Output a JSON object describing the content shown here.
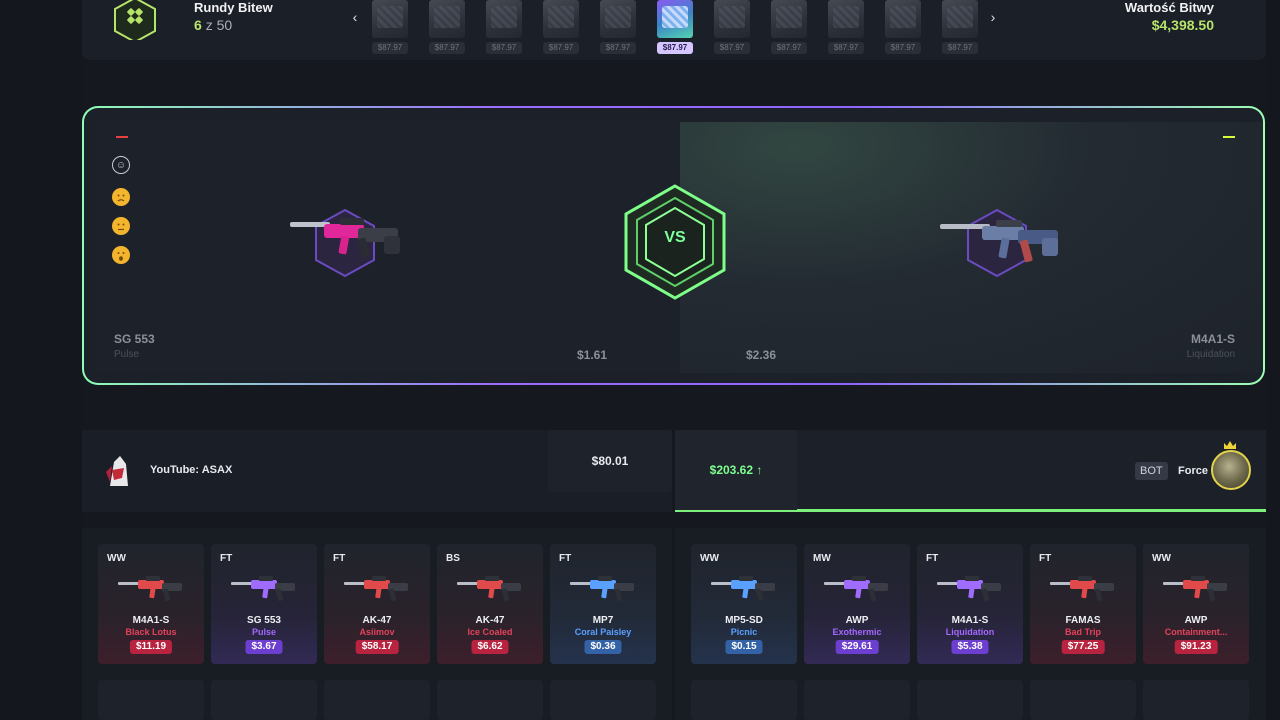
{
  "topbar": {
    "rounds_label": "Rundy Bitew",
    "rounds_current": "6",
    "rounds_sep": "z 50",
    "battle_value_label": "Wartość Bitwy",
    "battle_value": "$4,398.50",
    "nav_prev": "‹",
    "nav_next": "›",
    "cases": [
      {
        "price": "$87.97",
        "active": false
      },
      {
        "price": "$87.97",
        "active": false
      },
      {
        "price": "$87.97",
        "active": false
      },
      {
        "price": "$87.97",
        "active": false
      },
      {
        "price": "$87.97",
        "active": false
      },
      {
        "price": "$87.97",
        "active": true
      },
      {
        "price": "$87.97",
        "active": false
      },
      {
        "price": "$87.97",
        "active": false
      },
      {
        "price": "$87.97",
        "active": false
      },
      {
        "price": "$87.97",
        "active": false
      },
      {
        "price": "$87.97",
        "active": false
      }
    ]
  },
  "arena": {
    "vs": "VS",
    "left": {
      "name": "SG 553",
      "skin": "Pulse",
      "price": "$1.61"
    },
    "right": {
      "name": "M4A1-S",
      "skin": "Liquidation",
      "price": "$2.36"
    },
    "emojis": [
      "☺",
      "•",
      "•",
      "•"
    ]
  },
  "players": {
    "left": {
      "name": "YouTube: ASAX",
      "total": "$80.01"
    },
    "right": {
      "badge": "BOT",
      "name": "Force",
      "total": "$203.62 ↑"
    }
  },
  "items_left": [
    {
      "wear": "WW",
      "name": "M4A1-S",
      "skin": "Black Lotus",
      "price": "$11.19",
      "rarity": "red"
    },
    {
      "wear": "FT",
      "name": "SG 553",
      "skin": "Pulse",
      "price": "$3.67",
      "rarity": "purple"
    },
    {
      "wear": "FT",
      "name": "AK-47",
      "skin": "Asiimov",
      "price": "$58.17",
      "rarity": "red"
    },
    {
      "wear": "BS",
      "name": "AK-47",
      "skin": "Ice Coaled",
      "price": "$6.62",
      "rarity": "red"
    },
    {
      "wear": "FT",
      "name": "MP7",
      "skin": "Coral Paisley",
      "price": "$0.36",
      "rarity": "blue"
    }
  ],
  "items_right": [
    {
      "wear": "WW",
      "name": "MP5-SD",
      "skin": "Picnic",
      "price": "$0.15",
      "rarity": "blue"
    },
    {
      "wear": "MW",
      "name": "AWP",
      "skin": "Exothermic",
      "price": "$29.61",
      "rarity": "purple"
    },
    {
      "wear": "FT",
      "name": "M4A1-S",
      "skin": "Liquidation",
      "price": "$5.38",
      "rarity": "purple"
    },
    {
      "wear": "FT",
      "name": "FAMAS",
      "skin": "Bad Trip",
      "price": "$77.25",
      "rarity": "red"
    },
    {
      "wear": "WW",
      "name": "AWP",
      "skin": "Containment...",
      "price": "$91.23",
      "rarity": "red"
    }
  ]
}
